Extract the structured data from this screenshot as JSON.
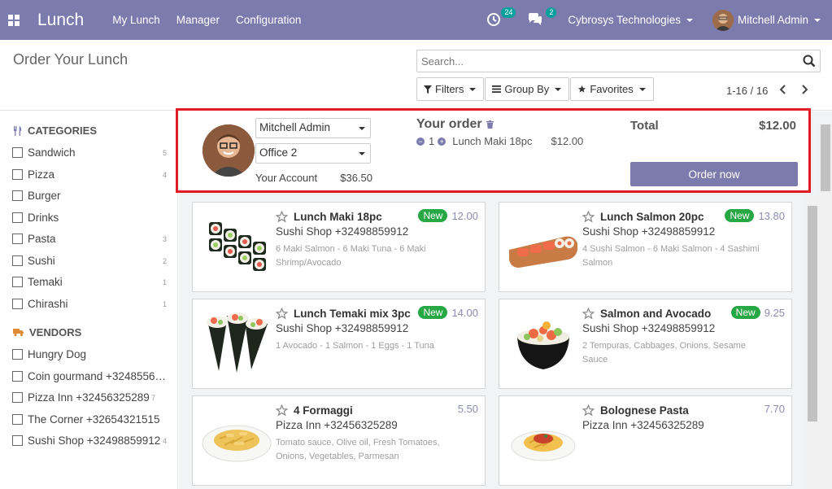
{
  "navbar": {
    "app_name": "Lunch",
    "menu": [
      "My Lunch",
      "Manager",
      "Configuration"
    ],
    "activity_count": "24",
    "message_count": "2",
    "company": "Cybrosys Technologies",
    "user": "Mitchell Admin",
    "bg_color": "#7c7bad"
  },
  "control_panel": {
    "title": "Order Your Lunch",
    "search_placeholder": "Search...",
    "filters_label": "Filters",
    "group_by_label": "Group By",
    "favorites_label": "Favorites",
    "pager": "1-16 / 16"
  },
  "sidebar": {
    "categories_title": "CATEGORIES",
    "categories": [
      {
        "label": "Sandwich",
        "count": "5"
      },
      {
        "label": "Pizza",
        "count": "4"
      },
      {
        "label": "Burger",
        "count": ""
      },
      {
        "label": "Drinks",
        "count": ""
      },
      {
        "label": "Pasta",
        "count": "3"
      },
      {
        "label": "Sushi",
        "count": "2"
      },
      {
        "label": "Temaki",
        "count": "1"
      },
      {
        "label": "Chirashi",
        "count": "1"
      }
    ],
    "vendors_title": "VENDORS",
    "vendors": [
      {
        "label": "Hungry Dog",
        "count": ""
      },
      {
        "label": "Coin gourmand +32485562…",
        "count": ""
      },
      {
        "label": "Pizza Inn +32456325289",
        "count": "7"
      },
      {
        "label": "The Corner +32654321515",
        "count": ""
      },
      {
        "label": "Sushi Shop +32498859912",
        "count": "4"
      }
    ]
  },
  "order": {
    "user_select": "Mitchell Admin",
    "location_select": "Office 2",
    "account_label": "Your Account",
    "account_value": "$36.50",
    "title": "Your order",
    "line_qty": "1",
    "line_name": "Lunch Maki 18pc",
    "line_price": "$12.00",
    "total_label": "Total",
    "total_value": "$12.00",
    "order_button": "Order now"
  },
  "products": [
    {
      "name": "Lunch Maki 18pc",
      "vendor": "Sushi Shop +32498859912",
      "desc": "6 Maki Salmon - 6 Maki Tuna - 6 Maki Shrimp/Avocado",
      "badge": "New",
      "price": "12.00",
      "icon": "maki-icon"
    },
    {
      "name": "Lunch Salmon 20pc",
      "vendor": "Sushi Shop +32498859912",
      "desc": "4 Sushi Salmon - 6 Maki Salmon - 4 Sashimi Salmon",
      "badge": "New",
      "price": "13.80",
      "icon": "salmon-plate-icon"
    },
    {
      "name": "Lunch Temaki mix 3pc",
      "vendor": "Sushi Shop +32498859912",
      "desc": "1 Avocado - 1 Salmon - 1 Eggs - 1 Tuna",
      "badge": "New",
      "price": "14.00",
      "icon": "temaki-icon"
    },
    {
      "name": "Salmon and Avocado",
      "vendor": "Sushi Shop +32498859912",
      "desc": "2 Tempuras, Cabbages, Onions, Sesame Sauce",
      "badge": "New",
      "price": "9.25",
      "icon": "salmon-bowl-icon"
    },
    {
      "name": "4 Formaggi",
      "vendor": "Pizza Inn +32456325289",
      "desc": "Tomato sauce, Olive oil, Fresh Tomatoes, Onions, Vegetables, Parmesan",
      "badge": "",
      "price": "5.50",
      "icon": "pasta-plate-icon"
    },
    {
      "name": "Bolognese Pasta",
      "vendor": "Pizza Inn +32456325289",
      "desc": "",
      "badge": "",
      "price": "7.70",
      "icon": "bolognese-icon"
    }
  ]
}
